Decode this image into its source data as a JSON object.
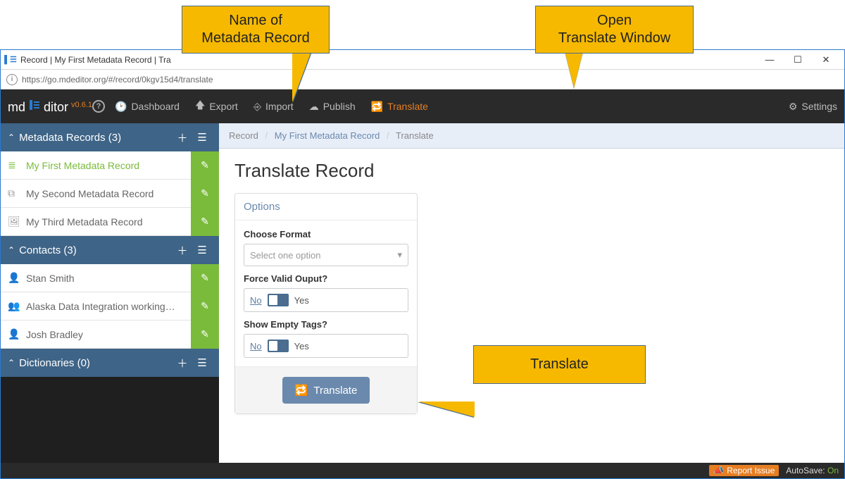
{
  "window": {
    "title": "Record | My First Metadata Record | Tra",
    "url": "https://go.mdeditor.org/#/record/0kgv15d4/translate"
  },
  "brand": {
    "md": "md",
    "ditor": "ditor",
    "version": "v0.6.1"
  },
  "nav": {
    "dashboard": "Dashboard",
    "export": "Export",
    "import": "Import",
    "publish": "Publish",
    "translate": "Translate",
    "settings": "Settings"
  },
  "sidebar": {
    "sections": [
      {
        "title": "Metadata Records (3)",
        "items": [
          {
            "label": "My First Metadata Record",
            "active": true
          },
          {
            "label": "My Second Metadata Record",
            "active": false
          },
          {
            "label": "My Third Metadata Record",
            "active": false
          }
        ]
      },
      {
        "title": "Contacts (3)",
        "items": [
          {
            "label": "Stan Smith"
          },
          {
            "label": "Alaska Data Integration working…"
          },
          {
            "label": "Josh Bradley"
          }
        ]
      },
      {
        "title": "Dictionaries (0)",
        "items": []
      }
    ]
  },
  "breadcrumb": {
    "root": "Record",
    "link": "My First Metadata Record",
    "current": "Translate"
  },
  "page": {
    "title": "Translate Record",
    "panel_title": "Options",
    "choose_format_label": "Choose Format",
    "choose_format_placeholder": "Select one option",
    "force_valid_label": "Force Valid Ouput?",
    "show_empty_label": "Show Empty Tags?",
    "toggle_no": "No",
    "toggle_yes": "Yes",
    "translate_btn": "Translate"
  },
  "status": {
    "report": "Report Issue",
    "autosave_label": "AutoSave:",
    "autosave_state": "On"
  },
  "callouts": {
    "record_name": "Name of\nMetadata Record",
    "open_translate": "Open\nTranslate Window",
    "translate": "Translate"
  },
  "colors": {
    "accent_orange": "#e67e22",
    "accent_green": "#7bbb3b",
    "brand_blue": "#3e6487",
    "callout_yellow": "#f6b900"
  }
}
